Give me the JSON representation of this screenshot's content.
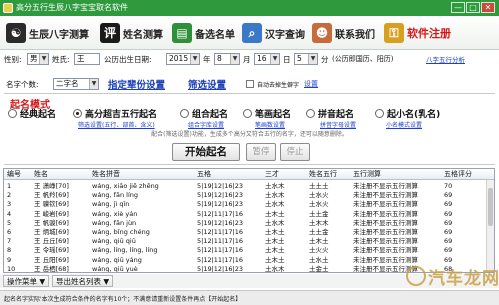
{
  "window": {
    "title": "高分五行生辰八字宝宝取名软件",
    "min": "—",
    "max": "□",
    "close": "✕"
  },
  "toolbar": {
    "items": [
      {
        "label": "生辰八字测算",
        "icon": "yin-yang-icon",
        "glyph": "☯",
        "color": "#2b2b2b"
      },
      {
        "label": "姓名测算",
        "icon": "book-icon",
        "glyph": "评",
        "color": "#1a1a1a"
      },
      {
        "label": "备选名单",
        "icon": "list-icon",
        "glyph": "▤",
        "color": "#2f8f3a"
      },
      {
        "label": "汉字查询",
        "icon": "search-icon",
        "glyph": "⌕",
        "color": "#3c78c8"
      },
      {
        "label": "联系我们",
        "icon": "contact-icon",
        "glyph": "☻",
        "color": "#c86a3c"
      },
      {
        "label": "软件注册",
        "icon": "lock-icon",
        "glyph": "🔒",
        "color": "#d8a020"
      }
    ]
  },
  "birth": {
    "gender_label": "性别:",
    "gender": "男",
    "surname_label": "姓氏:",
    "surname": "王",
    "date_label": "公历出生日期:",
    "year": "2015",
    "year_unit": "年",
    "month": "8",
    "month_unit": "月",
    "day": "16",
    "day_unit": "日",
    "hour": "5",
    "hour_unit": "分",
    "time_note": "(公历即国历、阳历)",
    "bazi_link": "八字五行分析"
  },
  "naming": {
    "count_label": "名字个数:",
    "count": "二字名",
    "setup_label": "指定辈份设置",
    "filter_label": "筛选设置",
    "auto_label": "自动去掉生僻字",
    "setting_link": "设置"
  },
  "mode": {
    "title": "起名模式",
    "options": [
      {
        "label": "经典起名",
        "sub": "",
        "checked": false
      },
      {
        "label": "高分超吉五行起名",
        "sub": "筛选设置(五行、部首、含义)",
        "checked": true
      },
      {
        "label": "组合起名",
        "sub": "组合字库设置",
        "checked": false
      },
      {
        "label": "笔画起名",
        "sub": "笔画数设置",
        "checked": false
      },
      {
        "label": "拼音起名",
        "sub": "拼音字母设置",
        "checked": false
      },
      {
        "label": "起小名(乳名)",
        "sub": "小名模式设置",
        "checked": false
      }
    ],
    "hint": "配合(筛选设置)功能，生成多个高分又符合五行的名字，还可以随意删除。"
  },
  "actions": {
    "start": "开始起名",
    "pause": "暂停",
    "stop": "停止"
  },
  "table": {
    "headers": [
      "编号",
      "姓名",
      "姓名拼音",
      "五格",
      "三才",
      "姓名五行",
      "五行测算",
      "五格评分"
    ],
    "rows": [
      [
        "1",
        "王 潇峥[70]",
        "wáng, xiāo  jiē  zhēng",
        "5|19|12|16|23",
        "土水木",
        "土土土",
        "未注册不显示五行测算",
        "70"
      ],
      [
        "2",
        "王 帆羚[69]",
        "wáng, fān  líng",
        "5|19|12|16|23",
        "土水木",
        "土水火",
        "未注册不显示五行测算",
        "69"
      ],
      [
        "3",
        "王 骥钦[69]",
        "wáng, jì  qīn",
        "5|19|12|16|23",
        "土水木",
        "土水火",
        "未注册不显示五行测算",
        "69"
      ],
      [
        "4",
        "王 峻岩[69]",
        "wáng, xiè  yán",
        "5|12|11|17|16",
        "土木土",
        "土土金",
        "未注册不显示五行测算",
        "69"
      ],
      [
        "5",
        "王 帆骏[69]",
        "wáng, fān  jùn",
        "5|19|12|16|23",
        "土水木",
        "土木木",
        "未注册不显示五行测算",
        "69"
      ],
      [
        "6",
        "王 炳城[69]",
        "wáng, bǐng  chéng",
        "5|12|11|17|16",
        "土木土",
        "土土金",
        "未注册不显示五行测算",
        "69"
      ],
      [
        "7",
        "王 丘丘[69]",
        "wáng, qiū  qiū",
        "5|12|11|17|16",
        "土木土",
        "土木土",
        "未注册不显示五行测算",
        "69"
      ],
      [
        "8",
        "王 令瑶[69]",
        "wáng, líng, líng, líng",
        "5|12|11|17|16",
        "土木土",
        "土火火",
        "未注册不显示五行测算",
        "69"
      ],
      [
        "9",
        "王 丘阳[69]",
        "wáng, qiū  yáng",
        "5|12|11|17|16",
        "土木土",
        "土水土",
        "未注册不显示五行测算",
        "69"
      ],
      [
        "10",
        "王 岳栖[68]",
        "wáng, qiū  yuè",
        "5|19|12|16|23",
        "土水木",
        "土金土",
        "未注册不显示五行测算",
        "68"
      ]
    ]
  },
  "bottom": {
    "ops": "操作菜单 ▼",
    "export": "导出姓名列表 ▼"
  },
  "status": "起名名字实际'本次生成符合条件的名字有10个；不满意请重新设置条件再点【开始起名】",
  "watermark": "汽车龙网"
}
